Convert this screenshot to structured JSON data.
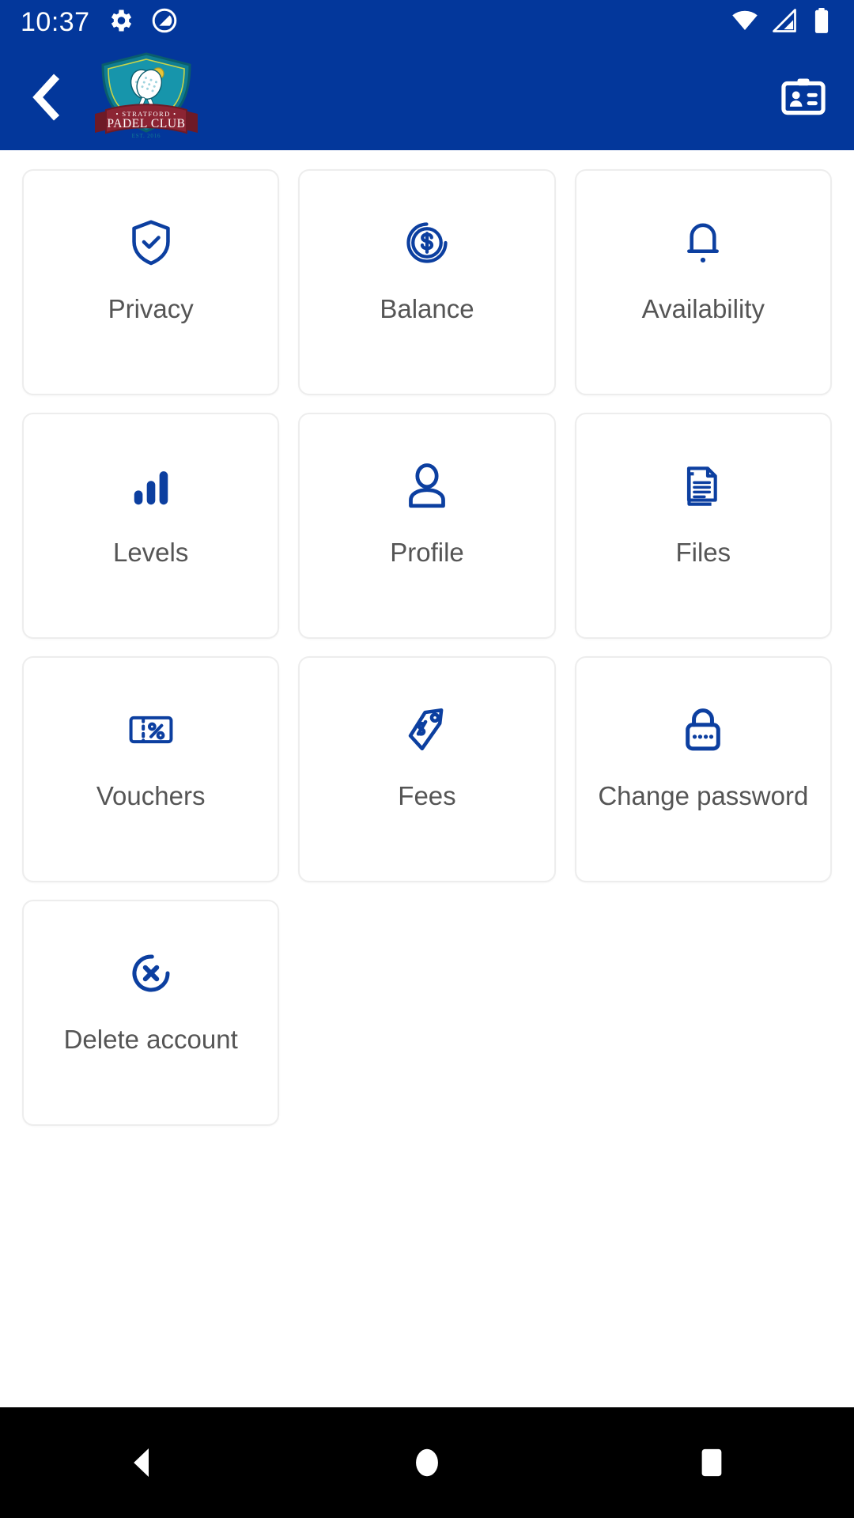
{
  "status_bar": {
    "time": "10:37",
    "left_icons": [
      {
        "name": "settings-gear-icon"
      },
      {
        "name": "do-not-disturb-icon"
      }
    ],
    "right_icons": [
      {
        "name": "wifi-icon"
      },
      {
        "name": "cellular-signal-icon"
      },
      {
        "name": "battery-full-icon"
      }
    ],
    "background_color": "#03379b",
    "foreground_color": "#ffffff"
  },
  "app_bar": {
    "back_label": "Back",
    "logo": {
      "name": "stratford-padel-club-logo",
      "line1": "STRATFORD",
      "line2": "PADEL CLUB",
      "line3": "EST. 2016",
      "shield_color": "#1a8ca0",
      "ribbon_color": "#8c2433",
      "ball_color": "#e8c63a"
    },
    "action_icon_label": "Membership card",
    "background_color": "#03379b"
  },
  "menu": {
    "accent_color": "#0c3fa0",
    "label_color": "#555555",
    "tile_border_color": "#ededed",
    "items": [
      {
        "id": "privacy",
        "label": "Privacy",
        "icon": "shield-check-icon"
      },
      {
        "id": "balance",
        "label": "Balance",
        "icon": "dollar-coin-icon"
      },
      {
        "id": "availability",
        "label": "Availability",
        "icon": "bell-icon"
      },
      {
        "id": "levels",
        "label": "Levels",
        "icon": "bar-chart-icon"
      },
      {
        "id": "profile",
        "label": "Profile",
        "icon": "person-icon"
      },
      {
        "id": "files",
        "label": "Files",
        "icon": "documents-icon"
      },
      {
        "id": "vouchers",
        "label": "Vouchers",
        "icon": "ticket-percent-icon"
      },
      {
        "id": "fees",
        "label": "Fees",
        "icon": "price-tag-dollar-icon"
      },
      {
        "id": "change-password",
        "label": "Change password",
        "icon": "padlock-dots-icon"
      },
      {
        "id": "delete-account",
        "label": "Delete account",
        "icon": "circle-x-icon"
      }
    ]
  },
  "nav_bar": {
    "background_color": "#000000",
    "buttons": [
      {
        "id": "back",
        "name": "android-back-button",
        "icon": "triangle-left-icon"
      },
      {
        "id": "home",
        "name": "android-home-button",
        "icon": "circle-icon"
      },
      {
        "id": "recents",
        "name": "android-recents-button",
        "icon": "square-icon"
      }
    ]
  }
}
